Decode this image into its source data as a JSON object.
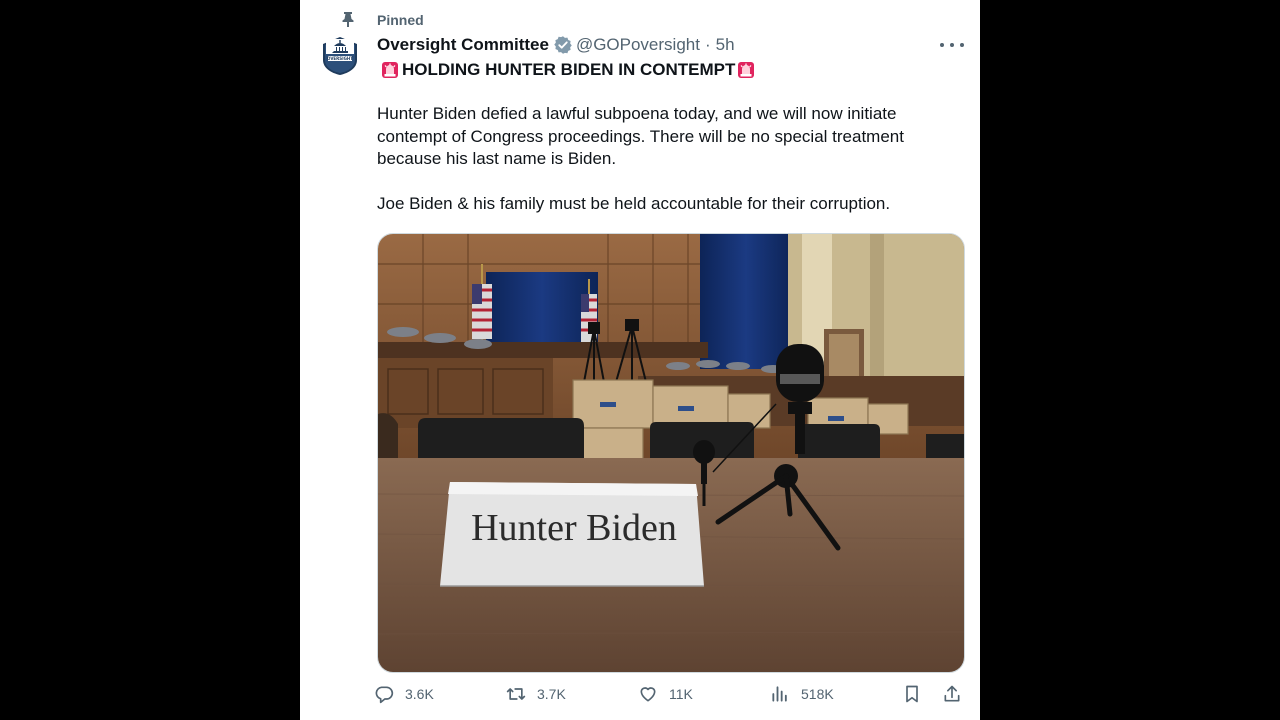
{
  "tweet": {
    "pinned_label": "Pinned",
    "author": {
      "display_name": "Oversight Committee",
      "handle": "@GOPoversight",
      "separator": "·",
      "timestamp": "5h",
      "verified": true,
      "avatar_text": "OVERSIGHT"
    },
    "headline": "HOLDING HUNTER BIDEN IN CONTEMPT",
    "paragraphs": [
      "Hunter Biden defied a lawful subpoena today, and we will now initiate contempt of Congress proceedings. There will be no special treatment because his last name is Biden.",
      "Joe Biden & his family must be held accountable for their corruption."
    ],
    "media": {
      "nameplate_text": "Hunter Biden"
    },
    "actions": {
      "replies": "3.6K",
      "reposts": "3.7K",
      "likes": "11K",
      "views": "518K"
    }
  },
  "icons": {
    "pin": "pin-icon",
    "verified": "verified-badge-icon",
    "more": "more-icon",
    "siren": "siren-emoji-icon",
    "reply": "reply-icon",
    "repost": "repost-icon",
    "like": "heart-icon",
    "views": "views-icon",
    "bookmark": "bookmark-icon",
    "share": "share-icon"
  },
  "colors": {
    "page_background": "#000000",
    "card_background": "#ffffff",
    "text_primary": "#0f1419",
    "text_secondary": "#536471",
    "verified_badge": "#829aab",
    "siren": "#e0245e"
  }
}
